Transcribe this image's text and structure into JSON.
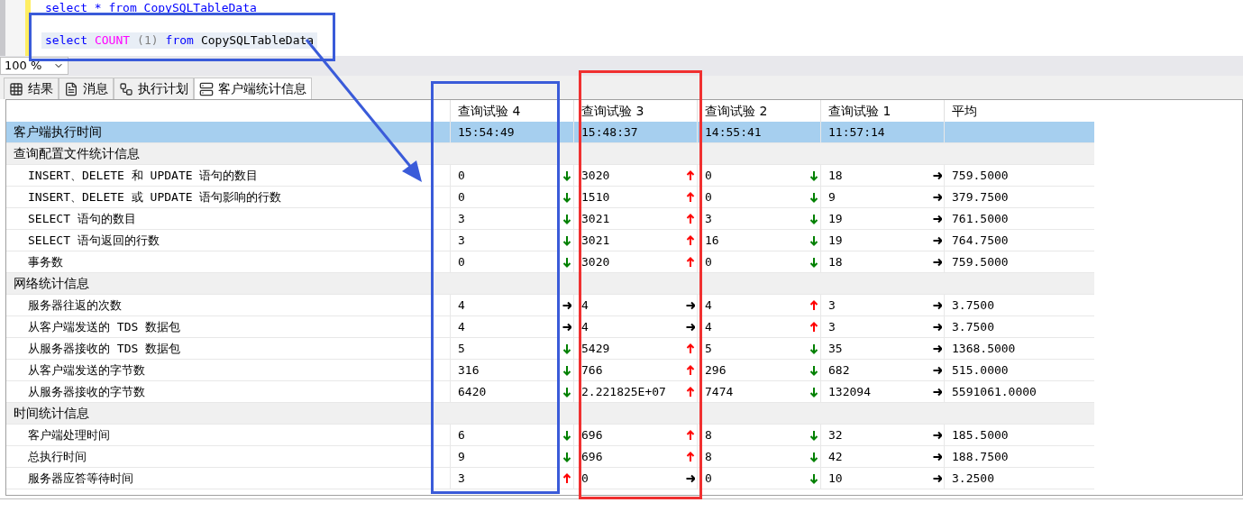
{
  "editor": {
    "lines": [
      {
        "kind": "plain",
        "tokens": [
          {
            "text": "select * from CopySQLTableData",
            "kind": "keyword"
          }
        ]
      },
      {
        "kind": "current",
        "tokens": [
          {
            "text": "select",
            "kind": "keyword"
          },
          {
            "text": "COUNT",
            "kind": "function"
          },
          {
            "text": "(1)",
            "kind": "punct"
          },
          {
            "text": "from",
            "kind": "keyword"
          },
          {
            "text": "CopySQLTableData",
            "kind": "ident"
          }
        ]
      }
    ]
  },
  "zoom": {
    "value": "100 %"
  },
  "tabs": [
    {
      "label": "结果",
      "selected": false
    },
    {
      "label": "消息",
      "selected": false
    },
    {
      "label": "执行计划",
      "selected": false
    },
    {
      "label": "客户端统计信息",
      "selected": true
    }
  ],
  "table": {
    "columns": [
      "查询试验 4",
      "查询试验 3",
      "查询试验 2",
      "查询试验 1",
      "平均"
    ],
    "rows": [
      {
        "kind": "time",
        "label": "客户端执行时间",
        "selected": true,
        "cells": [
          {
            "text": "15:54:49"
          },
          {
            "text": "15:48:37"
          },
          {
            "text": "14:55:41"
          },
          {
            "text": "11:57:14"
          }
        ]
      },
      {
        "kind": "section",
        "label": "查询配置文件统计信息",
        "selected": false
      },
      {
        "kind": "stat",
        "label": "INSERT、DELETE 和 UPDATE 语句的数目",
        "selected": false,
        "cells": [
          {
            "text": "0",
            "kind": "down"
          },
          {
            "text": "3020",
            "kind": "up"
          },
          {
            "text": "0",
            "kind": "down"
          },
          {
            "text": "18",
            "kind": "same"
          }
        ],
        "avg": "759.5000"
      },
      {
        "kind": "stat",
        "label": "INSERT、DELETE 或 UPDATE 语句影响的行数",
        "selected": false,
        "cells": [
          {
            "text": "0",
            "kind": "down"
          },
          {
            "text": "1510",
            "kind": "up"
          },
          {
            "text": "0",
            "kind": "down"
          },
          {
            "text": "9",
            "kind": "same"
          }
        ],
        "avg": "379.7500"
      },
      {
        "kind": "stat",
        "label": "SELECT 语句的数目",
        "selected": false,
        "cells": [
          {
            "text": "3",
            "kind": "down"
          },
          {
            "text": "3021",
            "kind": "up"
          },
          {
            "text": "3",
            "kind": "down"
          },
          {
            "text": "19",
            "kind": "same"
          }
        ],
        "avg": "761.5000"
      },
      {
        "kind": "stat",
        "label": "SELECT 语句返回的行数",
        "selected": false,
        "cells": [
          {
            "text": "3",
            "kind": "down"
          },
          {
            "text": "3021",
            "kind": "up"
          },
          {
            "text": "16",
            "kind": "down"
          },
          {
            "text": "19",
            "kind": "same"
          }
        ],
        "avg": "764.7500"
      },
      {
        "kind": "stat",
        "label": "事务数",
        "selected": false,
        "cells": [
          {
            "text": "0",
            "kind": "down"
          },
          {
            "text": "3020",
            "kind": "up"
          },
          {
            "text": "0",
            "kind": "down"
          },
          {
            "text": "18",
            "kind": "same"
          }
        ],
        "avg": "759.5000"
      },
      {
        "kind": "section",
        "label": "网络统计信息",
        "selected": false
      },
      {
        "kind": "stat",
        "label": "服务器往返的次数",
        "selected": false,
        "cells": [
          {
            "text": "4",
            "kind": "same"
          },
          {
            "text": "4",
            "kind": "same"
          },
          {
            "text": "4",
            "kind": "up"
          },
          {
            "text": "3",
            "kind": "same"
          }
        ],
        "avg": "3.7500"
      },
      {
        "kind": "stat",
        "label": "从客户端发送的 TDS 数据包",
        "selected": false,
        "cells": [
          {
            "text": "4",
            "kind": "same"
          },
          {
            "text": "4",
            "kind": "same"
          },
          {
            "text": "4",
            "kind": "up"
          },
          {
            "text": "3",
            "kind": "same"
          }
        ],
        "avg": "3.7500"
      },
      {
        "kind": "stat",
        "label": "从服务器接收的 TDS 数据包",
        "selected": false,
        "cells": [
          {
            "text": "5",
            "kind": "down"
          },
          {
            "text": "5429",
            "kind": "up"
          },
          {
            "text": "5",
            "kind": "down"
          },
          {
            "text": "35",
            "kind": "same"
          }
        ],
        "avg": "1368.5000"
      },
      {
        "kind": "stat",
        "label": "从客户端发送的字节数",
        "selected": false,
        "cells": [
          {
            "text": "316",
            "kind": "down"
          },
          {
            "text": "766",
            "kind": "up"
          },
          {
            "text": "296",
            "kind": "down"
          },
          {
            "text": "682",
            "kind": "same"
          }
        ],
        "avg": "515.0000"
      },
      {
        "kind": "stat",
        "label": "从服务器接收的字节数",
        "selected": false,
        "cells": [
          {
            "text": "6420",
            "kind": "down"
          },
          {
            "text": "2.221825E+07",
            "kind": "up"
          },
          {
            "text": "7474",
            "kind": "down"
          },
          {
            "text": "132094",
            "kind": "same"
          }
        ],
        "avg": "5591061.0000"
      },
      {
        "kind": "section",
        "label": "时间统计信息",
        "selected": false
      },
      {
        "kind": "stat",
        "label": "客户端处理时间",
        "selected": false,
        "cells": [
          {
            "text": "6",
            "kind": "down"
          },
          {
            "text": "696",
            "kind": "up"
          },
          {
            "text": "8",
            "kind": "down"
          },
          {
            "text": "32",
            "kind": "same"
          }
        ],
        "avg": "185.5000"
      },
      {
        "kind": "stat",
        "label": "总执行时间",
        "selected": false,
        "cells": [
          {
            "text": "9",
            "kind": "down"
          },
          {
            "text": "696",
            "kind": "up"
          },
          {
            "text": "8",
            "kind": "down"
          },
          {
            "text": "42",
            "kind": "same"
          }
        ],
        "avg": "188.7500"
      },
      {
        "kind": "stat",
        "label": "服务器应答等待时间",
        "selected": false,
        "cells": [
          {
            "text": "3",
            "kind": "up"
          },
          {
            "text": "0",
            "kind": "same"
          },
          {
            "text": "0",
            "kind": "down"
          },
          {
            "text": "10",
            "kind": "same"
          }
        ],
        "avg": "3.2500"
      }
    ]
  }
}
